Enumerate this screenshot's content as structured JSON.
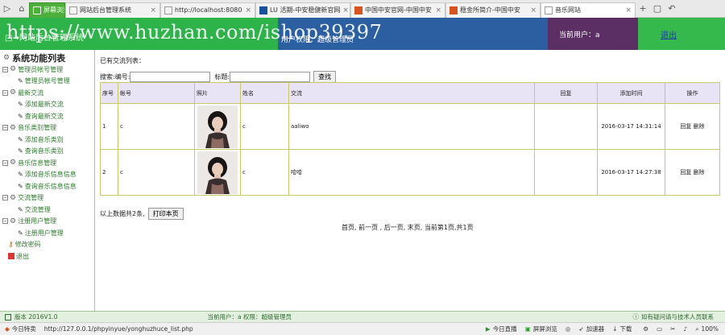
{
  "browser": {
    "tabs": [
      {
        "label": "屏幕浏览",
        "active": false
      },
      {
        "label": "网站后台管理系统",
        "active": false
      },
      {
        "label": "http://localhost:8080",
        "active": false
      },
      {
        "label": "LU 活期-中安稳健新官网",
        "active": false
      },
      {
        "label": "中国中安官网-中国中安",
        "active": false
      },
      {
        "label": "稳金所简介-中国中安",
        "active": false
      },
      {
        "label": "音乐网站",
        "active": true
      }
    ],
    "status_url": "http://127.0.0.1/phpyinyue/yonghuzhuce_list.php",
    "status_left": "今日特卖",
    "status_items": [
      "今日直播",
      "屏屏浏览",
      "加速器",
      "下载"
    ],
    "zoom": "100%"
  },
  "watermark": "https://www.huzhan.com/ishop39397",
  "header": {
    "left_text": "□→网站后台管理系统",
    "mid_text": "用户权限：超级管理员",
    "user_label": "当前用户：a",
    "logout": "退出"
  },
  "sidebar": {
    "title": "系统功能列表",
    "groups": [
      {
        "label": "管理员帐号管理",
        "items": [
          "管理员帐号管理"
        ]
      },
      {
        "label": "最新交流",
        "items": [
          "添加最新交流",
          "查询最新交流"
        ]
      },
      {
        "label": "音乐类别管理",
        "items": [
          "添加音乐类别",
          "查询音乐类别"
        ]
      },
      {
        "label": "音乐信息管理",
        "items": [
          "添加音乐信息信息",
          "查询音乐信息信息"
        ]
      },
      {
        "label": "交流管理",
        "items": [
          "交流管理"
        ]
      },
      {
        "label": "注册用户管理",
        "items": [
          "注册用户管理"
        ]
      }
    ],
    "extra": [
      {
        "label": "修改密码",
        "icon": "key-icon"
      },
      {
        "label": "退出",
        "icon": "exit-icon"
      }
    ]
  },
  "main": {
    "list_title": "已有交流列表：",
    "search": {
      "label": "搜索:",
      "field1_label": "编号:",
      "field1_value": "",
      "field2_label": "标题:",
      "field2_value": "",
      "button": "查找"
    },
    "columns": [
      "序号",
      "帐号",
      "照片",
      "姓名",
      "交流",
      "回复",
      "添加时间",
      "操作"
    ],
    "rows": [
      {
        "index": "1",
        "account": "c",
        "name": "c",
        "message": "aaliwo",
        "reply": "",
        "time": "2016-03-17 14:31:14",
        "actions": [
          "回复",
          "删除"
        ]
      },
      {
        "index": "2",
        "account": "c",
        "name": "c",
        "message": "哈哈",
        "reply": "",
        "time": "2016-03-17 14:27:38",
        "actions": [
          "回复",
          "删除"
        ]
      }
    ],
    "footnote": "以上数据共2条,",
    "print_button": "打印本页",
    "pager": "首页, 前一页 , 后一页, 末页, 当前第1页,共1页"
  },
  "statusbar": {
    "version": "版本 2016V1.0",
    "user": "当前用户：a 权限：超级管理员",
    "contact": "如有疑问请与技术人员联系"
  }
}
